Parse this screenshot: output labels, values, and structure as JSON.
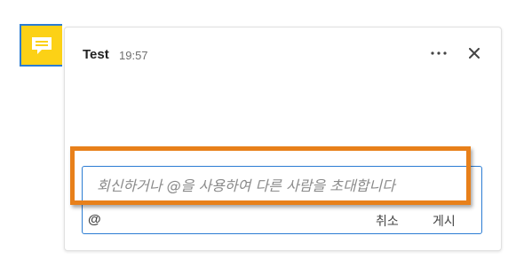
{
  "comment": {
    "author": "Test",
    "time": "19:57",
    "more_icon": "more-horizontal-icon",
    "close_icon": "close-icon",
    "anchor_icon": "comment-icon"
  },
  "reply": {
    "placeholder": "회신하거나 @을 사용하여 다른 사람을 초대합니다",
    "mention_label": "@",
    "cancel_label": "취소",
    "post_label": "게시"
  },
  "colors": {
    "anchor_fill": "#fcd116",
    "focus_blue": "#2b7cd3",
    "highlight_orange": "#e8801a"
  }
}
